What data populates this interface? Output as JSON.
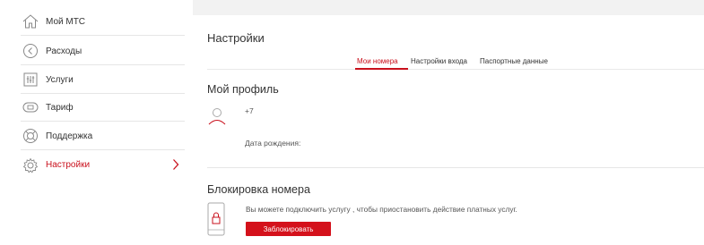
{
  "sidebar": {
    "items": [
      {
        "label": "Мой МТС",
        "icon": "home-icon"
      },
      {
        "label": "Расходы",
        "icon": "expenses-icon"
      },
      {
        "label": "Услуги",
        "icon": "services-icon"
      },
      {
        "label": "Тариф",
        "icon": "tariff-icon"
      },
      {
        "label": "Поддержка",
        "icon": "support-icon"
      },
      {
        "label": "Настройки",
        "icon": "settings-icon"
      }
    ]
  },
  "main": {
    "title": "Настройки",
    "tabs": [
      {
        "label": "Мои номера"
      },
      {
        "label": "Настройки входа"
      },
      {
        "label": "Паспортные данные"
      }
    ],
    "profile": {
      "title": "Мой профиль",
      "phone": "+7",
      "birth_label": "Дата рождения:"
    },
    "block": {
      "title": "Блокировка номера",
      "description": "Вы можете подключить услугу , чтобы приостановить действие платных услуг.",
      "button_label": "Заблокировать"
    }
  },
  "colors": {
    "accent": "#c9101c",
    "button": "#d4111b"
  }
}
